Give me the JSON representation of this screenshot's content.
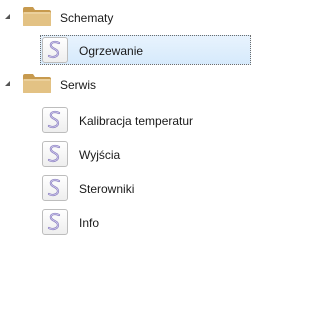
{
  "tree": {
    "groups": [
      {
        "label": "Schematy",
        "icon": "folder-icon",
        "expanded": true,
        "items": [
          {
            "label": "Ogrzewanie",
            "icon": "s-logo-icon",
            "selected": true
          }
        ]
      },
      {
        "label": "Serwis",
        "icon": "folder-icon",
        "expanded": true,
        "items": [
          {
            "label": "Kalibracja temperatur",
            "icon": "s-logo-icon",
            "selected": false
          },
          {
            "label": "Wyjścia",
            "icon": "s-logo-icon",
            "selected": false
          },
          {
            "label": "Sterowniki",
            "icon": "s-logo-icon",
            "selected": false
          },
          {
            "label": "Info",
            "icon": "s-logo-icon",
            "selected": false
          }
        ]
      }
    ]
  },
  "colors": {
    "selection_fill": "#d6eafc",
    "selection_border": "#6d6d6d",
    "folder": "#d9b36e",
    "icon_stroke": "#8a7fc0"
  }
}
